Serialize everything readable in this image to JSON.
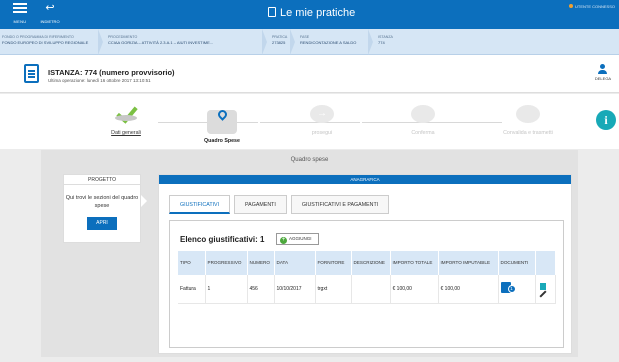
{
  "header": {
    "menu_label": "MENU",
    "back_label": "INDIETRO",
    "title": "Le mie pratiche",
    "user_label": "UTENTE CONNESSO"
  },
  "breadcrumb": [
    {
      "title": "FONDO O PROGRAMMA DI RIFERIMENTO",
      "value": "FONDO EUROPEO DI SVILUPPO REGIONALE"
    },
    {
      "title": "PROCEDIMENTO",
      "value": "CCIAA GORIZIA – ATTIVITÀ 2.3.A.1 – AIUTI INVESTIME..."
    },
    {
      "title": "PRATICA",
      "value": "273825"
    },
    {
      "title": "FASE",
      "value": "RENDICONTAZIONE A SALDO"
    },
    {
      "title": "ISTANZA",
      "value": "774"
    }
  ],
  "istanza": {
    "title": "ISTANZA: 774 (numero provvisorio)",
    "last_op": "Ultima operazione: lunedì 16 ottobre 2017 13:10:51",
    "delega_label": "DELEGA"
  },
  "steps": [
    {
      "label": "Dati generali",
      "state": "done"
    },
    {
      "label": "Quadro Spese",
      "state": "active"
    },
    {
      "label": "prosegui",
      "state": "next"
    },
    {
      "label": "Conferma",
      "state": "todo"
    },
    {
      "label": "Convalida e trasmetti",
      "state": "todo"
    }
  ],
  "section_title": "Quadro spese",
  "progetto": {
    "header": "PROGETTO",
    "text": "Qui trovi le sezioni del quadro spese",
    "button": "APRI"
  },
  "anagrafica": {
    "header": "ANAGRAFICA",
    "tabs": [
      "GIUSTIFICATIVI",
      "PAGAMENTI",
      "GIUSTIFICATIVI E PAGAMENTI"
    ],
    "active_tab": 0,
    "elenco_title": "Elenco giustificativi: 1",
    "add_button": "AGGIUNGI",
    "columns": [
      "TIPO",
      "PROGRESSIVO",
      "NUMERO",
      "DATA",
      "FORNITORE",
      "DESCRIZIONE",
      "IMPORTO TOTALE",
      "IMPORTO IMPUTABILE",
      "DOCUMENTI",
      ""
    ],
    "rows": [
      {
        "tipo": "Fattura",
        "progressivo": "1",
        "numero": "456",
        "data": "10/10/2017",
        "fornitore": "trgxt",
        "descrizione": "",
        "importo_totale": "€ 100,00",
        "importo_imputabile": "€ 100,00",
        "documenti_count": "1"
      }
    ]
  },
  "icons": {
    "menu": "hamburger-icon",
    "back": "back-arrow-icon",
    "title": "document-icon",
    "istanza": "document-icon",
    "delega": "user-delegate-icon",
    "info": "info-icon",
    "add": "plus-circle-icon",
    "documents": "document-badge-icon",
    "delete": "trash-icon",
    "edit": "pencil-icon"
  },
  "colors": {
    "brand_blue": "#0c6fbd",
    "success_green": "#7bc043",
    "info_teal": "#18a9b7",
    "table_header": "#d8e7f6"
  }
}
